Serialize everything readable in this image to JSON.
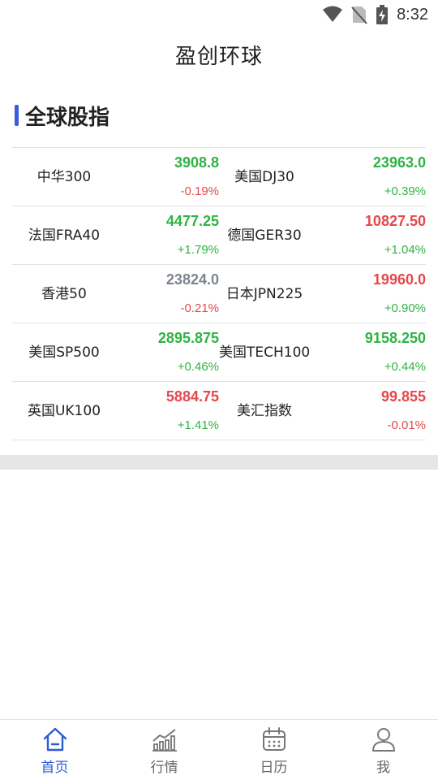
{
  "status_bar": {
    "time": "8:32"
  },
  "app": {
    "title": "盈创环球"
  },
  "section": {
    "title": "全球股指"
  },
  "indices": [
    {
      "name": "中华300",
      "price": "3908.8",
      "change": "-0.19%",
      "price_trend": "up",
      "change_trend": "down"
    },
    {
      "name": "美国DJ30",
      "price": "23963.0",
      "change": "+0.39%",
      "price_trend": "up",
      "change_trend": "up"
    },
    {
      "name": "法国FRA40",
      "price": "4477.25",
      "change": "+1.79%",
      "price_trend": "up",
      "change_trend": "up"
    },
    {
      "name": "德国GER30",
      "price": "10827.50",
      "change": "+1.04%",
      "price_trend": "down",
      "change_trend": "up"
    },
    {
      "name": "香港50",
      "price": "23824.0",
      "change": "-0.21%",
      "price_trend": "flat",
      "change_trend": "down"
    },
    {
      "name": "日本JPN225",
      "price": "19960.0",
      "change": "+0.90%",
      "price_trend": "down",
      "change_trend": "up"
    },
    {
      "name": "美国SP500",
      "price": "2895.875",
      "change": "+0.46%",
      "price_trend": "up",
      "change_trend": "up"
    },
    {
      "name": "美国TECH100",
      "price": "9158.250",
      "change": "+0.44%",
      "price_trend": "up",
      "change_trend": "up"
    },
    {
      "name": "英国UK100",
      "price": "5884.75",
      "change": "+1.41%",
      "price_trend": "down",
      "change_trend": "up"
    },
    {
      "name": "美汇指数",
      "price": "99.855",
      "change": "-0.01%",
      "price_trend": "down",
      "change_trend": "down"
    }
  ],
  "tabs": [
    {
      "label": "首页",
      "icon": "home-icon",
      "active": true
    },
    {
      "label": "行情",
      "icon": "chart-icon",
      "active": false
    },
    {
      "label": "日历",
      "icon": "calendar-icon",
      "active": false
    },
    {
      "label": "我",
      "icon": "user-icon",
      "active": false
    }
  ],
  "colors": {
    "up": "#2fb344",
    "down": "#e5484d",
    "flat": "#7d8590",
    "accent": "#2f5bd3"
  }
}
